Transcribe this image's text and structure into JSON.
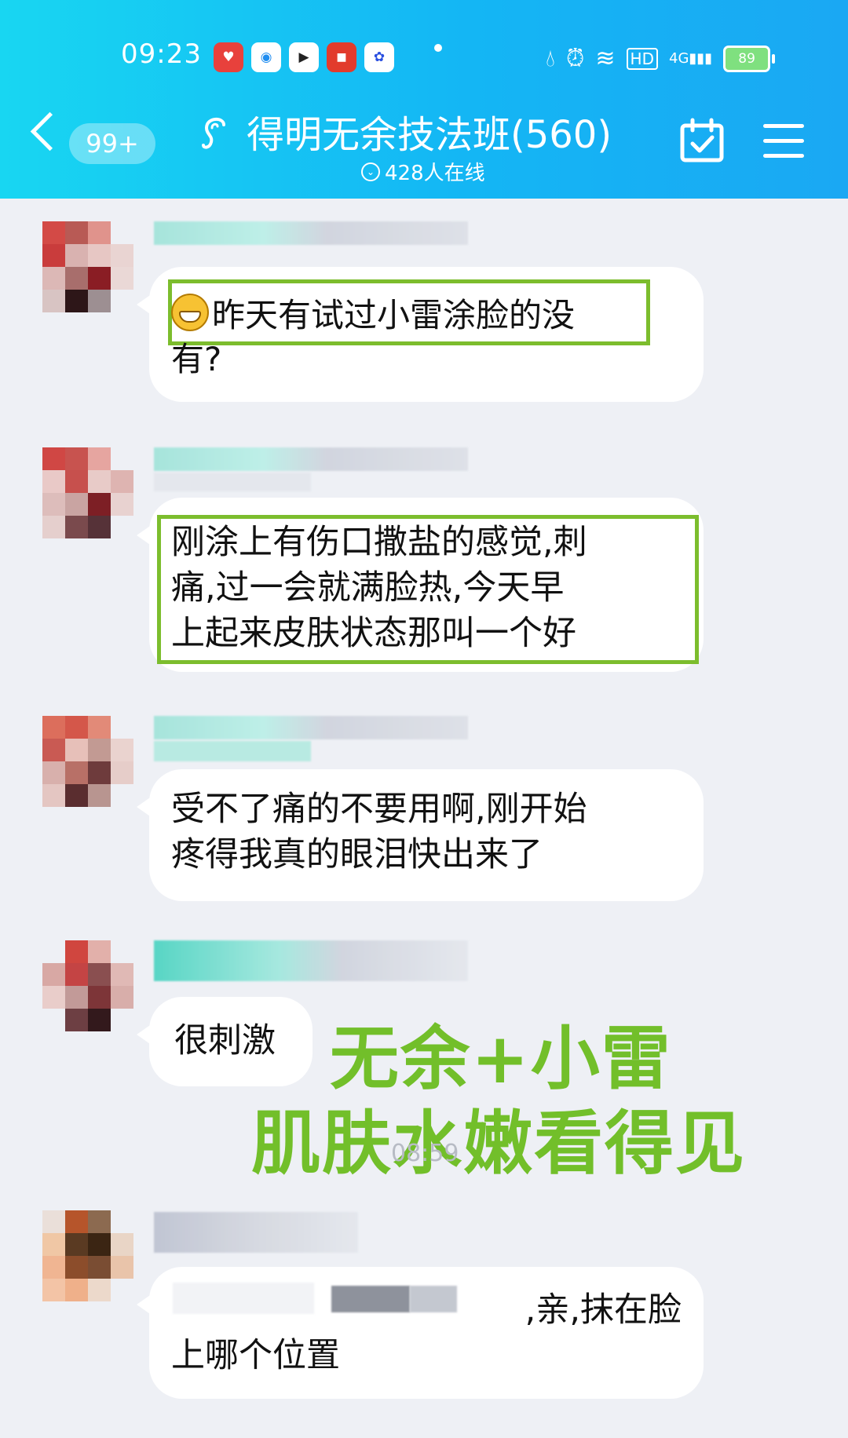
{
  "status_bar": {
    "time": "09:23",
    "battery": "89",
    "network": "4G",
    "hd": "HD"
  },
  "header": {
    "unread_badge": "99+",
    "group_title": "得明无余技法班(560)",
    "online_count": "428人在线"
  },
  "messages": [
    {
      "text_line1": "昨天有试过小雷涂脸的没",
      "text_line2": "有?"
    },
    {
      "text_line1": "刚涂上有伤口撒盐的感觉,刺",
      "text_line2": "痛,过一会就满脸热,今天早",
      "text_line3": "上起来皮肤状态那叫一个好"
    },
    {
      "text_line1": "受不了痛的不要用啊,刚开始",
      "text_line2": "疼得我真的眼泪快出来了"
    },
    {
      "text": "很刺激"
    },
    {
      "text_line1_visible": ",亲,抹在脸",
      "text_line2": "上哪个位置"
    }
  ],
  "overlay": {
    "line1": "无余+小雷",
    "line2": "肌肤水嫩看得见"
  },
  "timestamp": "08:59",
  "colors": {
    "header_start": "#18d6f2",
    "header_end": "#1aa8f3",
    "highlight_green": "#7cbd2d",
    "overlay_green": "#72bf2a",
    "chat_background": "#eef0f5"
  }
}
